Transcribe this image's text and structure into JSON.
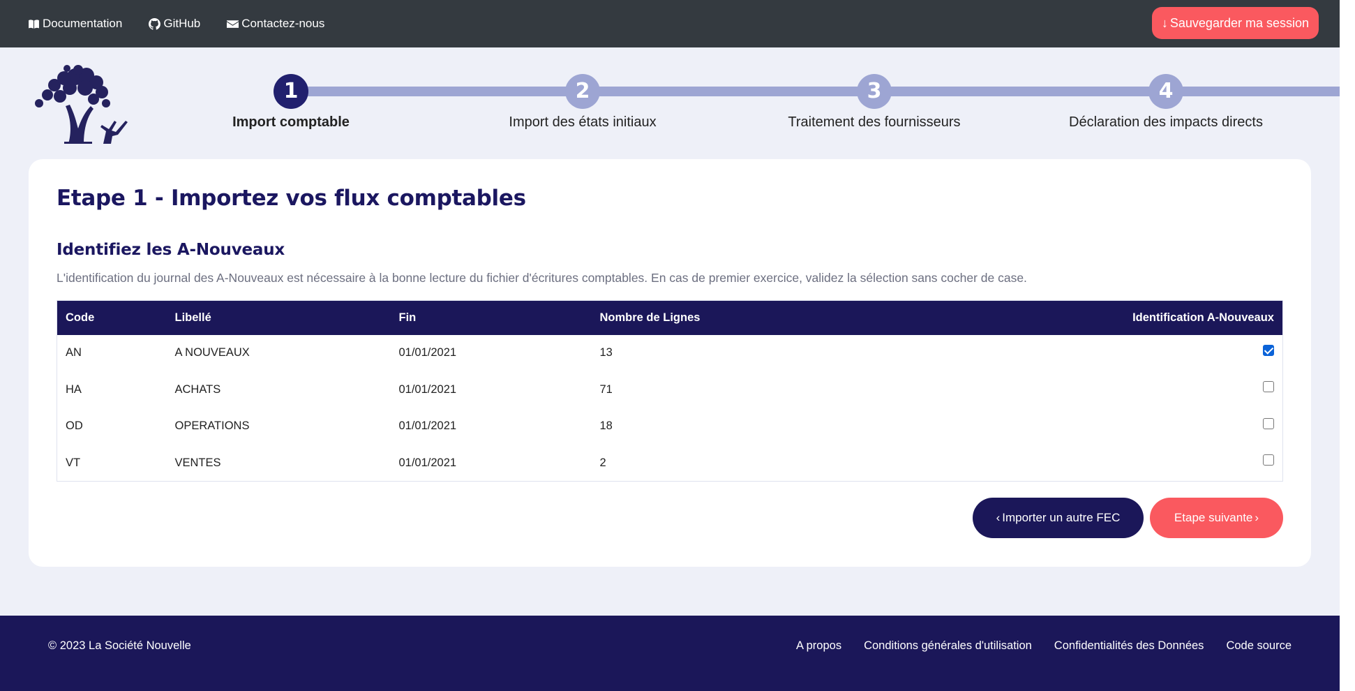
{
  "nav": {
    "documentation": "Documentation",
    "github": "GitHub",
    "contact": "Contactez-nous",
    "save": "Sauvegarder ma session"
  },
  "steps": [
    {
      "number": "1",
      "label": "Import comptable",
      "active": true
    },
    {
      "number": "2",
      "label": "Import des états initiaux",
      "active": false
    },
    {
      "number": "3",
      "label": "Traitement des fournisseurs",
      "active": false
    },
    {
      "number": "4",
      "label": "Déclaration des impacts directs",
      "active": false
    }
  ],
  "main": {
    "title": "Etape 1 - Importez vos flux comptables",
    "subtitle": "Identifiez les A-Nouveaux",
    "description": "L'identification du journal des A-Nouveaux est nécessaire à la bonne lecture du fichier d'écritures comptables. En cas de premier exercice, validez la sélection sans cocher de case."
  },
  "table": {
    "headers": [
      "Code",
      "Libellé",
      "Fin",
      "Nombre de Lignes",
      "Identification A-Nouveaux"
    ],
    "rows": [
      {
        "code": "AN",
        "libelle": "A NOUVEAUX",
        "fin": "01/01/2021",
        "lignes": "13",
        "checked": true
      },
      {
        "code": "HA",
        "libelle": "ACHATS",
        "fin": "01/01/2021",
        "lignes": "71",
        "checked": false
      },
      {
        "code": "OD",
        "libelle": "OPERATIONS",
        "fin": "01/01/2021",
        "lignes": "18",
        "checked": false
      },
      {
        "code": "VT",
        "libelle": "VENTES",
        "fin": "01/01/2021",
        "lignes": "2",
        "checked": false
      }
    ]
  },
  "actions": {
    "prev": "Importer un autre FEC",
    "next": "Etape suivante"
  },
  "footer": {
    "copyright": "© 2023 La Société Nouvelle",
    "links": [
      "A propos",
      "Conditions générales d'utilisation",
      "Confidentialités des Données",
      "Code source"
    ]
  },
  "colors": {
    "navy": "#1b1759",
    "coral": "#fa595f",
    "stepInactive": "#9da5d3",
    "topbar": "#343a40"
  }
}
